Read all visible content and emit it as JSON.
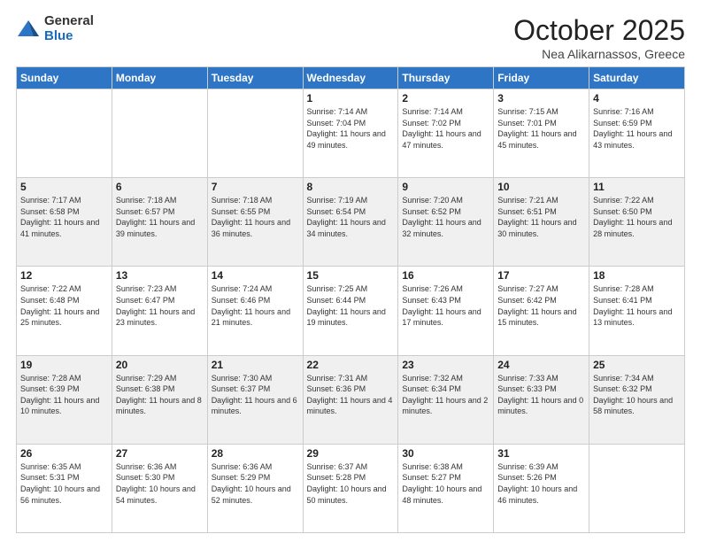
{
  "logo": {
    "general": "General",
    "blue": "Blue"
  },
  "header": {
    "month_year": "October 2025",
    "location": "Nea Alikarnassos, Greece"
  },
  "weekdays": [
    "Sunday",
    "Monday",
    "Tuesday",
    "Wednesday",
    "Thursday",
    "Friday",
    "Saturday"
  ],
  "weeks": [
    [
      {
        "day": "",
        "sunrise": "",
        "sunset": "",
        "daylight": ""
      },
      {
        "day": "",
        "sunrise": "",
        "sunset": "",
        "daylight": ""
      },
      {
        "day": "",
        "sunrise": "",
        "sunset": "",
        "daylight": ""
      },
      {
        "day": "1",
        "sunrise": "Sunrise: 7:14 AM",
        "sunset": "Sunset: 7:04 PM",
        "daylight": "Daylight: 11 hours and 49 minutes."
      },
      {
        "day": "2",
        "sunrise": "Sunrise: 7:14 AM",
        "sunset": "Sunset: 7:02 PM",
        "daylight": "Daylight: 11 hours and 47 minutes."
      },
      {
        "day": "3",
        "sunrise": "Sunrise: 7:15 AM",
        "sunset": "Sunset: 7:01 PM",
        "daylight": "Daylight: 11 hours and 45 minutes."
      },
      {
        "day": "4",
        "sunrise": "Sunrise: 7:16 AM",
        "sunset": "Sunset: 6:59 PM",
        "daylight": "Daylight: 11 hours and 43 minutes."
      }
    ],
    [
      {
        "day": "5",
        "sunrise": "Sunrise: 7:17 AM",
        "sunset": "Sunset: 6:58 PM",
        "daylight": "Daylight: 11 hours and 41 minutes."
      },
      {
        "day": "6",
        "sunrise": "Sunrise: 7:18 AM",
        "sunset": "Sunset: 6:57 PM",
        "daylight": "Daylight: 11 hours and 39 minutes."
      },
      {
        "day": "7",
        "sunrise": "Sunrise: 7:18 AM",
        "sunset": "Sunset: 6:55 PM",
        "daylight": "Daylight: 11 hours and 36 minutes."
      },
      {
        "day": "8",
        "sunrise": "Sunrise: 7:19 AM",
        "sunset": "Sunset: 6:54 PM",
        "daylight": "Daylight: 11 hours and 34 minutes."
      },
      {
        "day": "9",
        "sunrise": "Sunrise: 7:20 AM",
        "sunset": "Sunset: 6:52 PM",
        "daylight": "Daylight: 11 hours and 32 minutes."
      },
      {
        "day": "10",
        "sunrise": "Sunrise: 7:21 AM",
        "sunset": "Sunset: 6:51 PM",
        "daylight": "Daylight: 11 hours and 30 minutes."
      },
      {
        "day": "11",
        "sunrise": "Sunrise: 7:22 AM",
        "sunset": "Sunset: 6:50 PM",
        "daylight": "Daylight: 11 hours and 28 minutes."
      }
    ],
    [
      {
        "day": "12",
        "sunrise": "Sunrise: 7:22 AM",
        "sunset": "Sunset: 6:48 PM",
        "daylight": "Daylight: 11 hours and 25 minutes."
      },
      {
        "day": "13",
        "sunrise": "Sunrise: 7:23 AM",
        "sunset": "Sunset: 6:47 PM",
        "daylight": "Daylight: 11 hours and 23 minutes."
      },
      {
        "day": "14",
        "sunrise": "Sunrise: 7:24 AM",
        "sunset": "Sunset: 6:46 PM",
        "daylight": "Daylight: 11 hours and 21 minutes."
      },
      {
        "day": "15",
        "sunrise": "Sunrise: 7:25 AM",
        "sunset": "Sunset: 6:44 PM",
        "daylight": "Daylight: 11 hours and 19 minutes."
      },
      {
        "day": "16",
        "sunrise": "Sunrise: 7:26 AM",
        "sunset": "Sunset: 6:43 PM",
        "daylight": "Daylight: 11 hours and 17 minutes."
      },
      {
        "day": "17",
        "sunrise": "Sunrise: 7:27 AM",
        "sunset": "Sunset: 6:42 PM",
        "daylight": "Daylight: 11 hours and 15 minutes."
      },
      {
        "day": "18",
        "sunrise": "Sunrise: 7:28 AM",
        "sunset": "Sunset: 6:41 PM",
        "daylight": "Daylight: 11 hours and 13 minutes."
      }
    ],
    [
      {
        "day": "19",
        "sunrise": "Sunrise: 7:28 AM",
        "sunset": "Sunset: 6:39 PM",
        "daylight": "Daylight: 11 hours and 10 minutes."
      },
      {
        "day": "20",
        "sunrise": "Sunrise: 7:29 AM",
        "sunset": "Sunset: 6:38 PM",
        "daylight": "Daylight: 11 hours and 8 minutes."
      },
      {
        "day": "21",
        "sunrise": "Sunrise: 7:30 AM",
        "sunset": "Sunset: 6:37 PM",
        "daylight": "Daylight: 11 hours and 6 minutes."
      },
      {
        "day": "22",
        "sunrise": "Sunrise: 7:31 AM",
        "sunset": "Sunset: 6:36 PM",
        "daylight": "Daylight: 11 hours and 4 minutes."
      },
      {
        "day": "23",
        "sunrise": "Sunrise: 7:32 AM",
        "sunset": "Sunset: 6:34 PM",
        "daylight": "Daylight: 11 hours and 2 minutes."
      },
      {
        "day": "24",
        "sunrise": "Sunrise: 7:33 AM",
        "sunset": "Sunset: 6:33 PM",
        "daylight": "Daylight: 11 hours and 0 minutes."
      },
      {
        "day": "25",
        "sunrise": "Sunrise: 7:34 AM",
        "sunset": "Sunset: 6:32 PM",
        "daylight": "Daylight: 10 hours and 58 minutes."
      }
    ],
    [
      {
        "day": "26",
        "sunrise": "Sunrise: 6:35 AM",
        "sunset": "Sunset: 5:31 PM",
        "daylight": "Daylight: 10 hours and 56 minutes."
      },
      {
        "day": "27",
        "sunrise": "Sunrise: 6:36 AM",
        "sunset": "Sunset: 5:30 PM",
        "daylight": "Daylight: 10 hours and 54 minutes."
      },
      {
        "day": "28",
        "sunrise": "Sunrise: 6:36 AM",
        "sunset": "Sunset: 5:29 PM",
        "daylight": "Daylight: 10 hours and 52 minutes."
      },
      {
        "day": "29",
        "sunrise": "Sunrise: 6:37 AM",
        "sunset": "Sunset: 5:28 PM",
        "daylight": "Daylight: 10 hours and 50 minutes."
      },
      {
        "day": "30",
        "sunrise": "Sunrise: 6:38 AM",
        "sunset": "Sunset: 5:27 PM",
        "daylight": "Daylight: 10 hours and 48 minutes."
      },
      {
        "day": "31",
        "sunrise": "Sunrise: 6:39 AM",
        "sunset": "Sunset: 5:26 PM",
        "daylight": "Daylight: 10 hours and 46 minutes."
      },
      {
        "day": "",
        "sunrise": "",
        "sunset": "",
        "daylight": ""
      }
    ]
  ],
  "row_shading": [
    false,
    true,
    false,
    true,
    false
  ]
}
